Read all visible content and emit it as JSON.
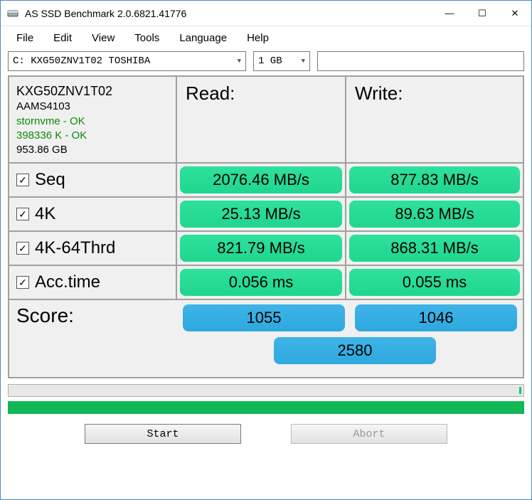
{
  "window": {
    "title": "AS SSD Benchmark 2.0.6821.41776"
  },
  "menu": {
    "file": "File",
    "edit": "Edit",
    "view": "View",
    "tools": "Tools",
    "language": "Language",
    "help": "Help"
  },
  "controls": {
    "drive": "C: KXG50ZNV1T02 TOSHIBA",
    "size": "1 GB"
  },
  "drive_info": {
    "model": "KXG50ZNV1T02",
    "firmware": "AAMS4103",
    "driver": "stornvme - OK",
    "alignment": "398336 K - OK",
    "capacity": "953.86 GB"
  },
  "headers": {
    "read": "Read:",
    "write": "Write:"
  },
  "tests": {
    "seq": {
      "label": "Seq",
      "read": "2076.46 MB/s",
      "write": "877.83 MB/s"
    },
    "k4": {
      "label": "4K",
      "read": "25.13 MB/s",
      "write": "89.63 MB/s"
    },
    "k4_64": {
      "label": "4K-64Thrd",
      "read": "821.79 MB/s",
      "write": "868.31 MB/s"
    },
    "acc": {
      "label": "Acc.time",
      "read": "0.056 ms",
      "write": "0.055 ms"
    }
  },
  "score": {
    "label": "Score:",
    "read": "1055",
    "write": "1046",
    "total": "2580"
  },
  "buttons": {
    "start": "Start",
    "abort": "Abort"
  },
  "icons": {
    "checkmark": "✓",
    "chevron": "▼",
    "minimize": "—",
    "maximize": "☐",
    "close": "✕"
  }
}
